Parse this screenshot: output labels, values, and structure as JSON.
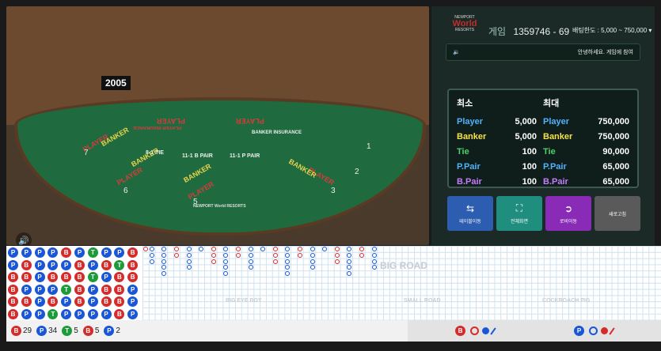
{
  "video": {
    "table_number": "2005",
    "sound_icon": "speaker-icon",
    "seat_labels": [
      "PLAYER",
      "BANKER",
      "PLAYER",
      "BANKER",
      "PLAYER",
      "BANKER",
      "PLAYER",
      "BANKER"
    ],
    "seat_numbers": [
      "7",
      "6",
      "5",
      "3",
      "2",
      "1"
    ],
    "felt_labels": {
      "tie": "8-1 TIE",
      "bpair": "11-1 B PAIR",
      "ppair": "11-1 P PAIR",
      "brand": "NEWPORT World RESORTS",
      "insurance": "BANKER INSURANCE",
      "pinsurance": "PLAYER INSURANCE",
      "player_top_left": "PLAYER",
      "player_top_right": "PLAYER"
    }
  },
  "side": {
    "logo_top": "NEWPORT",
    "logo_mid": "World",
    "logo_bot": "RESORTS",
    "game_label": "게임",
    "game_id": "1359746 - 69",
    "bet_limit": "배팅한도 : 5,000 ~ 750,000",
    "notice": "안녕하세요. 게임에 참여",
    "limits": {
      "min_header": "최소",
      "max_header": "최대",
      "rows": [
        {
          "name": "Player",
          "min": "5,000",
          "max": "750,000",
          "color": "#4fb3ff"
        },
        {
          "name": "Banker",
          "min": "5,000",
          "max": "750,000",
          "color": "#f5e14a"
        },
        {
          "name": "Tie",
          "min": "100",
          "max": "90,000",
          "color": "#4bd36b"
        },
        {
          "name": "P.Pair",
          "min": "100",
          "max": "65,000",
          "color": "#4fb3ff"
        },
        {
          "name": "B.Pair",
          "min": "100",
          "max": "65,000",
          "color": "#c57bff"
        }
      ]
    },
    "buttons": [
      {
        "label": "테이블이동",
        "icon": "swap-icon",
        "color": "#2d5db0"
      },
      {
        "label": "전체화면",
        "icon": "fullscreen-icon",
        "color": "#1f8e7e"
      },
      {
        "label": "로비이동",
        "icon": "exit-icon",
        "color": "#8a2bb8"
      },
      {
        "label": "새로고침",
        "icon": "refresh-icon",
        "color": "#5a5a5a"
      }
    ]
  },
  "roads": {
    "big_road_label": "BIG ROAD",
    "big_eye_label": "BIG EYE BOY",
    "small_road_label": "SMALL ROAD",
    "cockroach_label": "COCKROACH PIG",
    "bead_plate": [
      [
        "P",
        "P",
        "P",
        "P",
        "B",
        "P",
        "T",
        "P",
        "P",
        "B"
      ],
      [
        "P",
        "B",
        "P",
        "P",
        "P",
        "B",
        "P",
        "B",
        "T",
        "B"
      ],
      [
        "B",
        "B",
        "P",
        "B",
        "B",
        "B",
        "T",
        "P",
        "B",
        "B"
      ],
      [
        "B",
        "P",
        "P",
        "P",
        "T",
        "B",
        "P",
        "B",
        "B",
        "P"
      ],
      [
        "B",
        "B",
        "P",
        "B",
        "P",
        "B",
        "P",
        "B",
        "B",
        "P"
      ],
      [
        "B",
        "P",
        "P",
        "T",
        "P",
        "P",
        "P",
        "P",
        "B",
        "P"
      ]
    ]
  },
  "summary": {
    "banker_label": "B",
    "banker_count": "29",
    "player_label": "P",
    "player_count": "34",
    "tie_label": "T",
    "tie_count": "5",
    "bpair_label": "B",
    "bpair_count": "5",
    "ppair_label": "P",
    "ppair_count": "2"
  },
  "colors": {
    "banker": "#d62b2b",
    "player": "#1a56d6",
    "tie": "#1d9b3a"
  }
}
